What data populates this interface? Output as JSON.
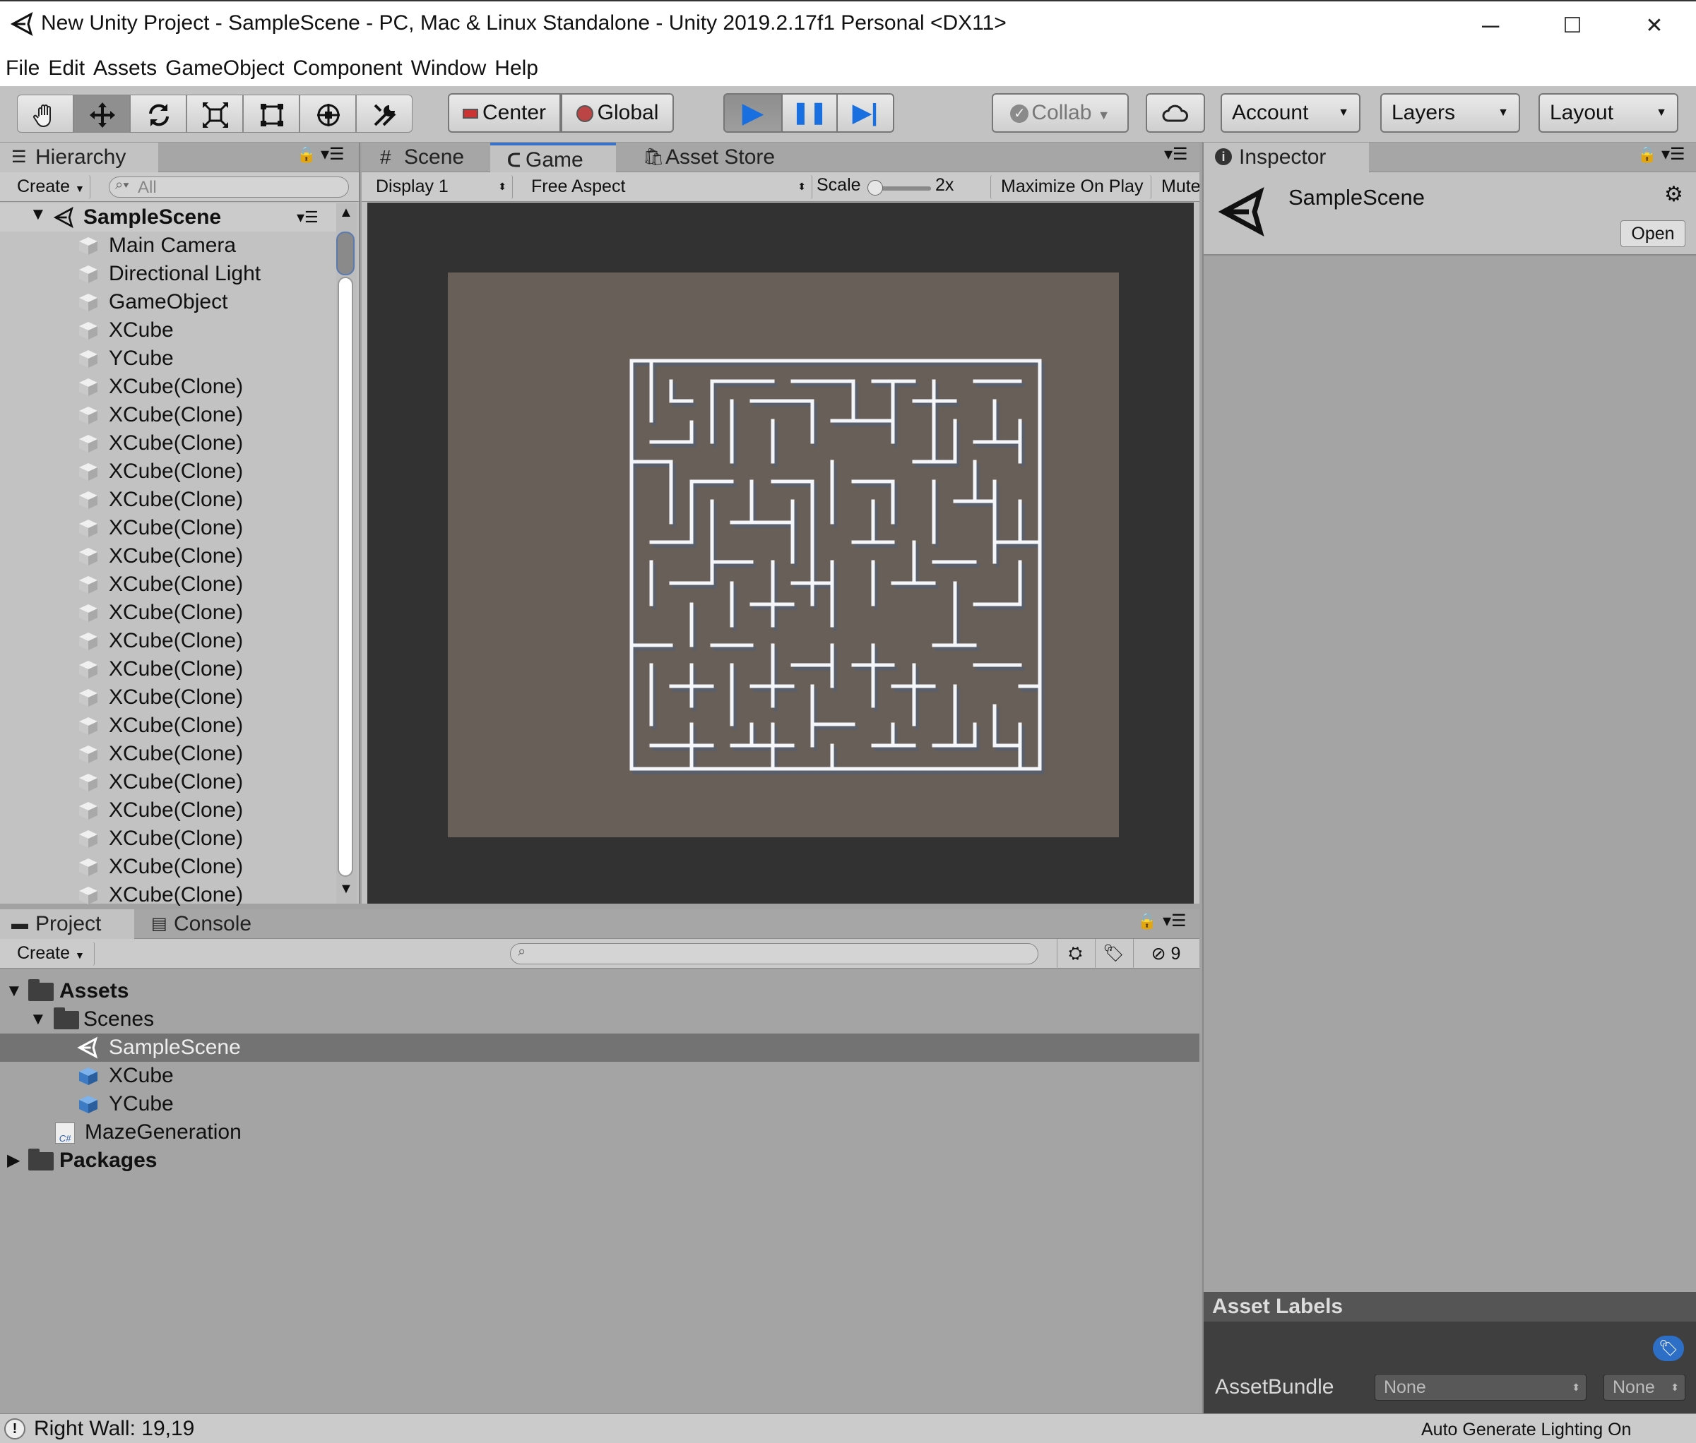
{
  "window": {
    "title": "New Unity Project - SampleScene - PC, Mac & Linux Standalone - Unity 2019.2.17f1 Personal <DX11>",
    "controls": [
      "─",
      "☐",
      "✕"
    ]
  },
  "menu": [
    "File",
    "Edit",
    "Assets",
    "GameObject",
    "Component",
    "Window",
    "Help"
  ],
  "toolbar": {
    "tools": [
      "hand-icon",
      "move-icon",
      "rotate-icon",
      "scale-icon",
      "rect-icon",
      "transform-icon",
      "custom-tool-icon"
    ],
    "pivot": "Center",
    "space": "Global",
    "play_icon": "▶",
    "pause_icon": "❚❚",
    "step_icon": "▶|",
    "collab": "Collab",
    "account": "Account",
    "layers": "Layers",
    "layout": "Layout"
  },
  "hierarchy": {
    "tab": "Hierarchy",
    "create": "Create",
    "search_placeholder": "All",
    "scene": "SampleScene",
    "items": [
      "Main Camera",
      "Directional Light",
      "GameObject",
      "XCube",
      "YCube",
      "XCube(Clone)",
      "XCube(Clone)",
      "XCube(Clone)",
      "XCube(Clone)",
      "XCube(Clone)",
      "XCube(Clone)",
      "XCube(Clone)",
      "XCube(Clone)",
      "XCube(Clone)",
      "XCube(Clone)",
      "XCube(Clone)",
      "XCube(Clone)",
      "XCube(Clone)",
      "XCube(Clone)",
      "XCube(Clone)",
      "XCube(Clone)",
      "XCube(Clone)",
      "XCube(Clone)",
      "XCube(Clone)"
    ]
  },
  "gameview": {
    "tabs": [
      "Scene",
      "Game",
      "Asset Store"
    ],
    "display": "Display 1",
    "aspect": "Free Aspect",
    "scale_label": "Scale",
    "scale_value": "2x",
    "maximize": "Maximize On Play",
    "mute": "Mute"
  },
  "inspector": {
    "tab": "Inspector",
    "object": "SampleScene",
    "open": "Open",
    "asset_labels": "Asset Labels",
    "asset_bundle_label": "AssetBundle",
    "bundle_value": "None",
    "variant_value": "None"
  },
  "project": {
    "tabs": [
      "Project",
      "Console"
    ],
    "create": "Create",
    "hidden_count": "9",
    "tree": {
      "assets": "Assets",
      "scenes": "Scenes",
      "sample_scene": "SampleScene",
      "xcube": "XCube",
      "ycube": "YCube",
      "script": "MazeGeneration",
      "script_badge": "C#",
      "packages": "Packages"
    }
  },
  "status": {
    "message": "Right Wall: 19,19",
    "lighting": "Auto Generate Lighting On"
  },
  "colors": {
    "accent": "#3a72c8",
    "selected_row": "#737373",
    "game_bg": "#323232",
    "maze_floor": "#685f58"
  }
}
